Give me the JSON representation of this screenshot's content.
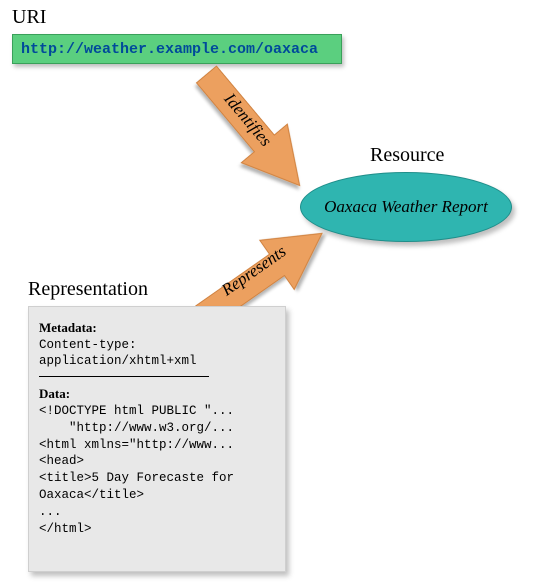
{
  "uri": {
    "heading": "URI",
    "value": "http://weather.example.com/oaxaca"
  },
  "resource": {
    "heading": "Resource",
    "label": "Oaxaca Weather Report"
  },
  "representation": {
    "heading": "Representation",
    "metadata_title": "Metadata:",
    "metadata_lines": "Content-type:\napplication/xhtml+xml",
    "data_title": "Data:",
    "data_lines": "<!DOCTYPE html PUBLIC \"...\n    \"http://www.w3.org/...\n<html xmlns=\"http://www...\n<head>\n<title>5 Day Forecaste for\nOaxaca</title>\n...\n</html>"
  },
  "arrows": {
    "identifies": "Identifies",
    "represents": "Represents"
  }
}
